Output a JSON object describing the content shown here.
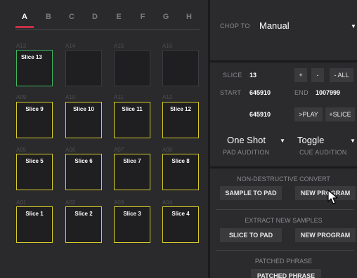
{
  "banks": [
    "A",
    "B",
    "C",
    "D",
    "E",
    "F",
    "G",
    "H"
  ],
  "pad_rows": [
    [
      {
        "id": "A13",
        "label": "Slice 13",
        "state": "selected"
      },
      {
        "id": "A14",
        "label": "",
        "state": "empty"
      },
      {
        "id": "A15",
        "label": "",
        "state": "empty"
      },
      {
        "id": "A16",
        "label": "",
        "state": "empty"
      }
    ],
    [
      {
        "id": "A09",
        "label": "Slice 9",
        "state": "assigned"
      },
      {
        "id": "A10",
        "label": "Slice 10",
        "state": "assigned"
      },
      {
        "id": "A11",
        "label": "Slice 11",
        "state": "assigned"
      },
      {
        "id": "A12",
        "label": "Slice 12",
        "state": "assigned"
      }
    ],
    [
      {
        "id": "A05",
        "label": "Slice 5",
        "state": "assigned"
      },
      {
        "id": "A06",
        "label": "Slice 6",
        "state": "assigned"
      },
      {
        "id": "A07",
        "label": "Slice 7",
        "state": "assigned"
      },
      {
        "id": "A08",
        "label": "Slice 8",
        "state": "assigned"
      }
    ],
    [
      {
        "id": "A01",
        "label": "Slice 1",
        "state": "assigned"
      },
      {
        "id": "A02",
        "label": "Slice 2",
        "state": "assigned"
      },
      {
        "id": "A03",
        "label": "Slice 3",
        "state": "assigned"
      },
      {
        "id": "A04",
        "label": "Slice 4",
        "state": "assigned"
      }
    ]
  ],
  "chop": {
    "label": "CHOP TO",
    "value": "Manual"
  },
  "slice": {
    "slice_label": "SLICE",
    "slice_value": "13",
    "plus": "+",
    "minus": "-",
    "minus_all": "- ALL",
    "start_label": "START",
    "start_value": "645910",
    "end_label": "END",
    "end_value": "1007999",
    "pos_value": "645910",
    "play": ">PLAY",
    "add_slice": "+SLICE"
  },
  "audition": {
    "pad_value": "One Shot",
    "pad_label": "PAD AUDITION",
    "cue_value": "Toggle",
    "cue_label": "CUE AUDITION"
  },
  "convert": {
    "heading": "NON-DESTRUCTIVE CONVERT",
    "sample_to_pad": "SAMPLE TO PAD",
    "new_program": "NEW PROGRAM"
  },
  "extract": {
    "heading": "EXTRACT NEW SAMPLES",
    "slice_to_pad": "SLICE TO PAD",
    "new_program": "NEW PROGRAM"
  },
  "phrase": {
    "heading": "PATCHED PHRASE",
    "button": "PATCHED PHRASE"
  },
  "colors": {
    "selected_tab": "#c93048",
    "assigned_border": "#d6cc2a",
    "selected_border": "#3fb55e"
  }
}
